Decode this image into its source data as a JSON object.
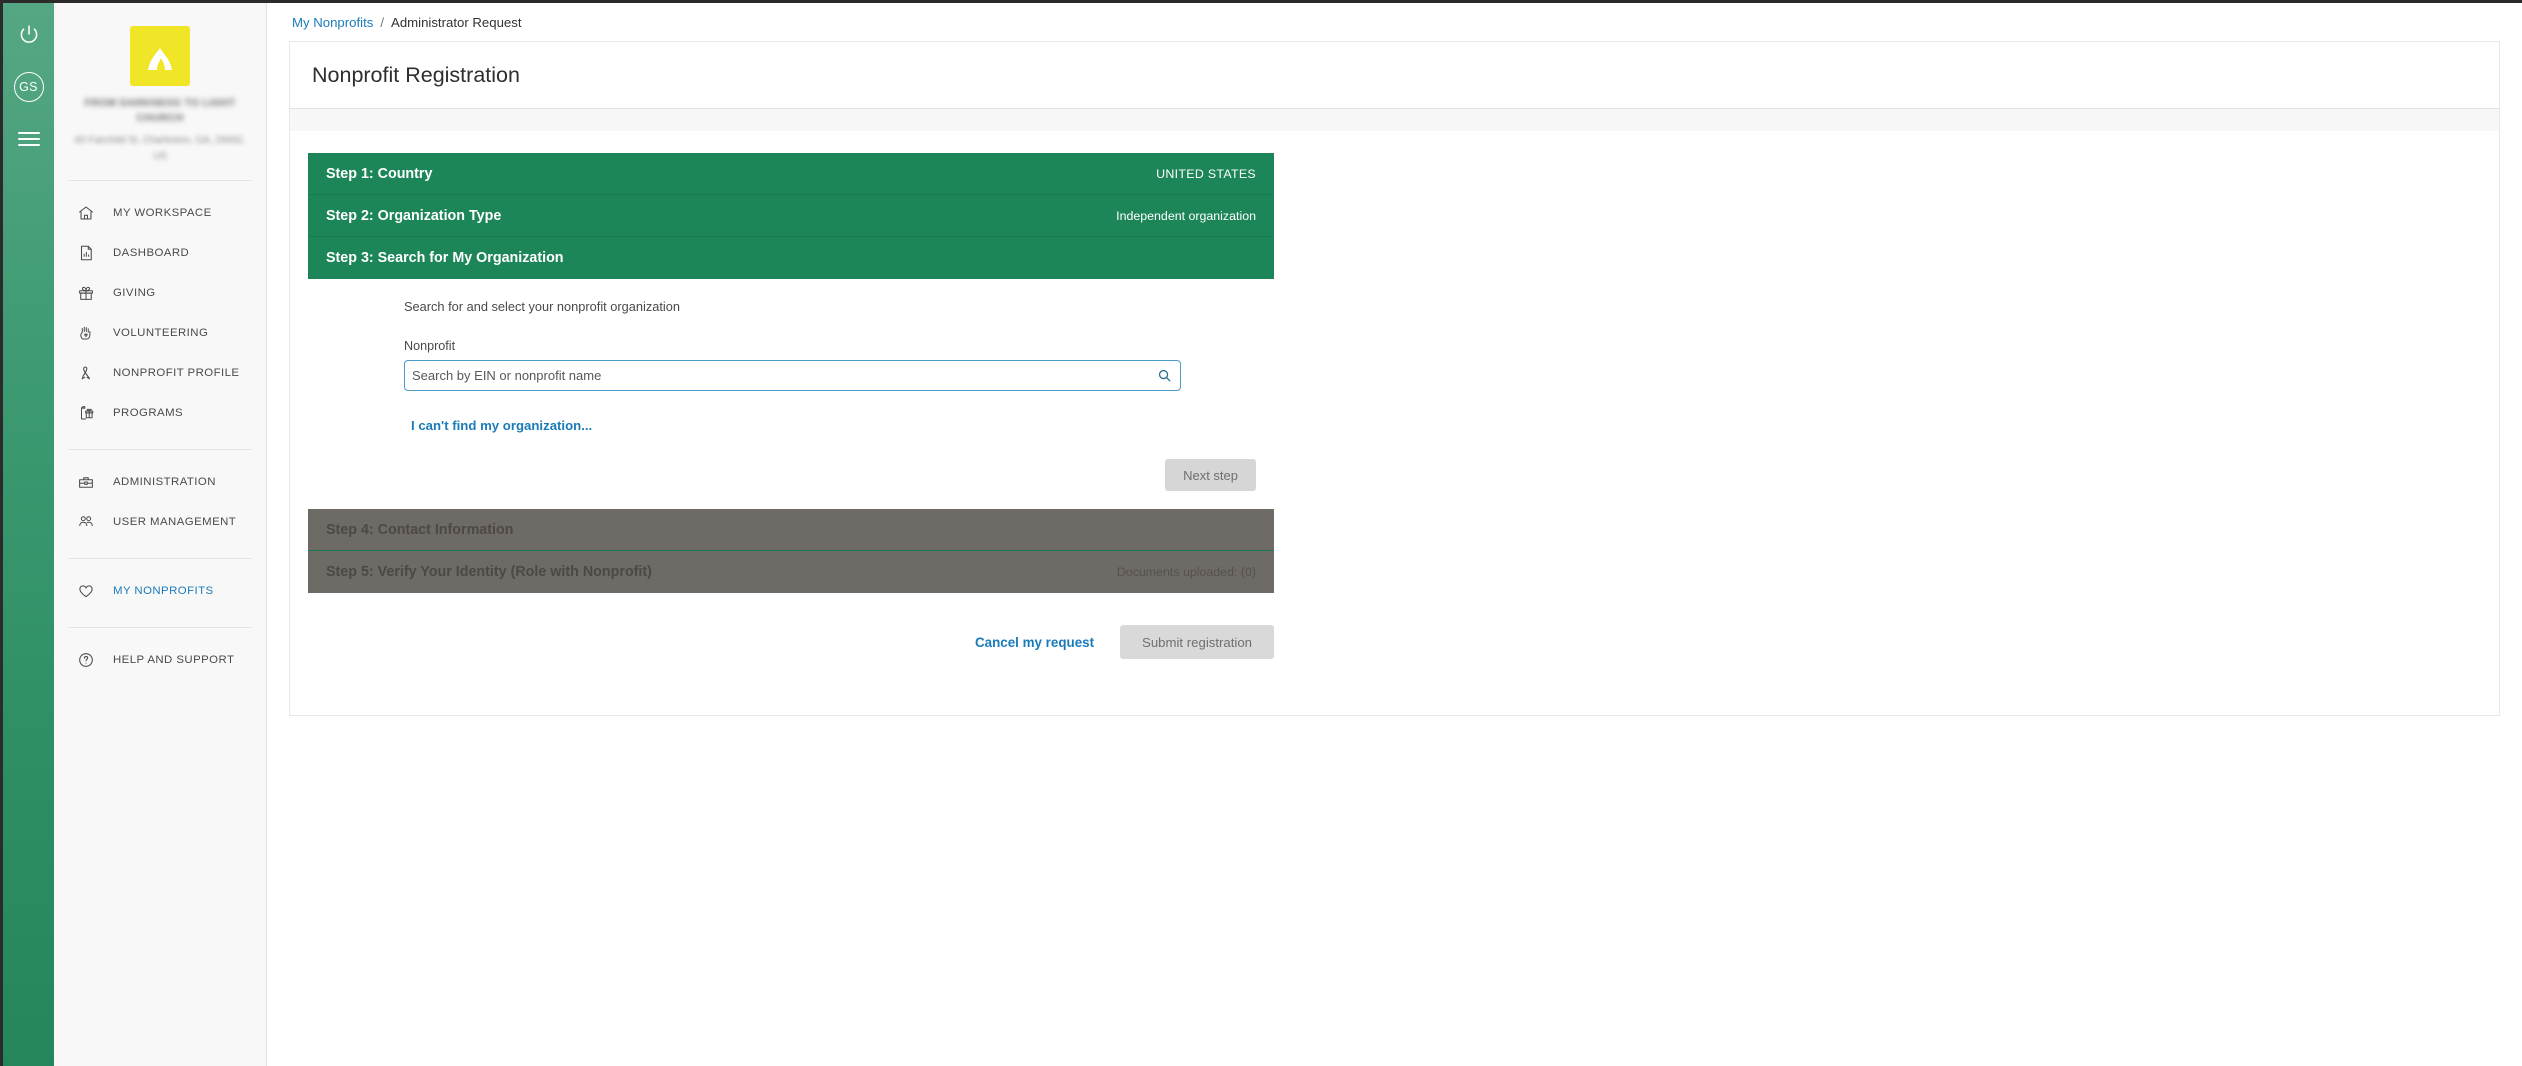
{
  "rail": {
    "power_icon": "power-icon",
    "avatar_initials": "GS",
    "menu_icon": "hamburger-menu-icon"
  },
  "sidebar": {
    "org_name": "FROM DARKNESS TO LIGHT CHURCH",
    "org_address": "60 Fairchild St, Charleston, GA, 29492, US",
    "items": [
      {
        "label": "MY WORKSPACE",
        "icon": "home-icon",
        "active": false
      },
      {
        "label": "DASHBOARD",
        "icon": "document-chart-icon",
        "active": false
      },
      {
        "label": "GIVING",
        "icon": "gift-icon",
        "active": false
      },
      {
        "label": "VOLUNTEERING",
        "icon": "hand-heart-icon",
        "active": false
      },
      {
        "label": "NONPROFIT PROFILE",
        "icon": "ribbon-icon",
        "active": false
      },
      {
        "label": "PROGRAMS",
        "icon": "clipboard-gift-icon",
        "active": false
      },
      {
        "label": "ADMINISTRATION",
        "icon": "toolbox-icon",
        "active": false
      },
      {
        "label": "USER MANAGEMENT",
        "icon": "people-icon",
        "active": false
      },
      {
        "label": "MY NONPROFITS",
        "icon": "heart-icon",
        "active": true
      },
      {
        "label": "HELP AND SUPPORT",
        "icon": "question-circle-icon",
        "active": false
      }
    ]
  },
  "breadcrumb": {
    "parent": "My Nonprofits",
    "separator": "/",
    "current": "Administrator Request"
  },
  "page": {
    "title": "Nonprofit Registration"
  },
  "steps": [
    {
      "title": "Step 1: Country",
      "value": "UNITED STATES",
      "state": "complete"
    },
    {
      "title": "Step 2: Organization Type",
      "value": "Independent organization",
      "state": "complete"
    },
    {
      "title": "Step 3: Search for My Organization",
      "value": "",
      "state": "active"
    }
  ],
  "disabled_steps": [
    {
      "title": "Step 4: Contact Information",
      "value": ""
    },
    {
      "title": "Step 5: Verify Your Identity (Role with Nonprofit)",
      "value": "Documents uploaded: (0)"
    }
  ],
  "search_panel": {
    "description": "Search for and select your nonprofit organization",
    "field_label": "Nonprofit",
    "placeholder": "Search by EIN or nonprofit name",
    "input_value": "",
    "search_icon": "search-icon",
    "cant_find_link": "I can't find my organization...",
    "next_button": "Next step"
  },
  "footer_actions": {
    "cancel_link": "Cancel my request",
    "submit_button": "Submit registration"
  },
  "colors": {
    "rail_green": "#3d9a72",
    "step_green": "#1d8659",
    "step_disabled_grey": "#6e6a66",
    "link_blue": "#1a7bb9",
    "logo_yellow": "#f0e526"
  }
}
